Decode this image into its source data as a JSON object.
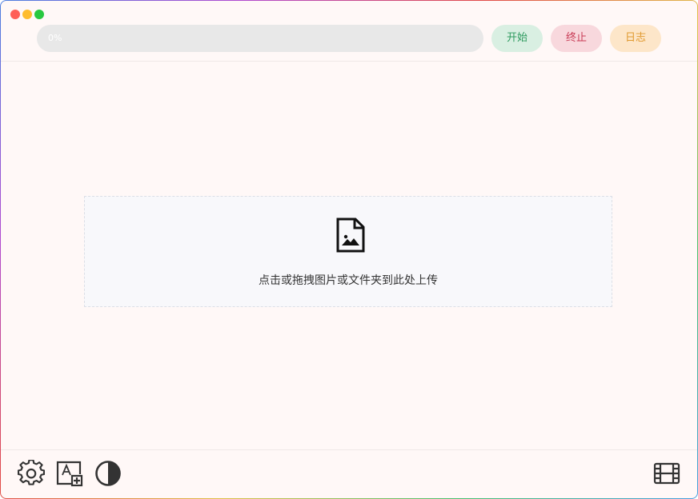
{
  "window": {
    "traffic_lights": [
      "red",
      "yellow",
      "green"
    ]
  },
  "toolbar": {
    "progress_percent": 0,
    "progress_text": "0%",
    "start_label": "开始",
    "stop_label": "终止",
    "log_label": "日志"
  },
  "upload": {
    "icon": "image-file-icon",
    "text": "点击或拖拽图片或文件夹到此处上传"
  },
  "bottom_bar": {
    "left_icons": [
      "gear-icon",
      "font-add-icon",
      "contrast-icon"
    ],
    "right_icons": [
      "film-icon"
    ]
  },
  "colors": {
    "start": "#2e9a5f",
    "stop": "#c83a55",
    "log": "#e09a30",
    "background": "#fff8f7"
  }
}
